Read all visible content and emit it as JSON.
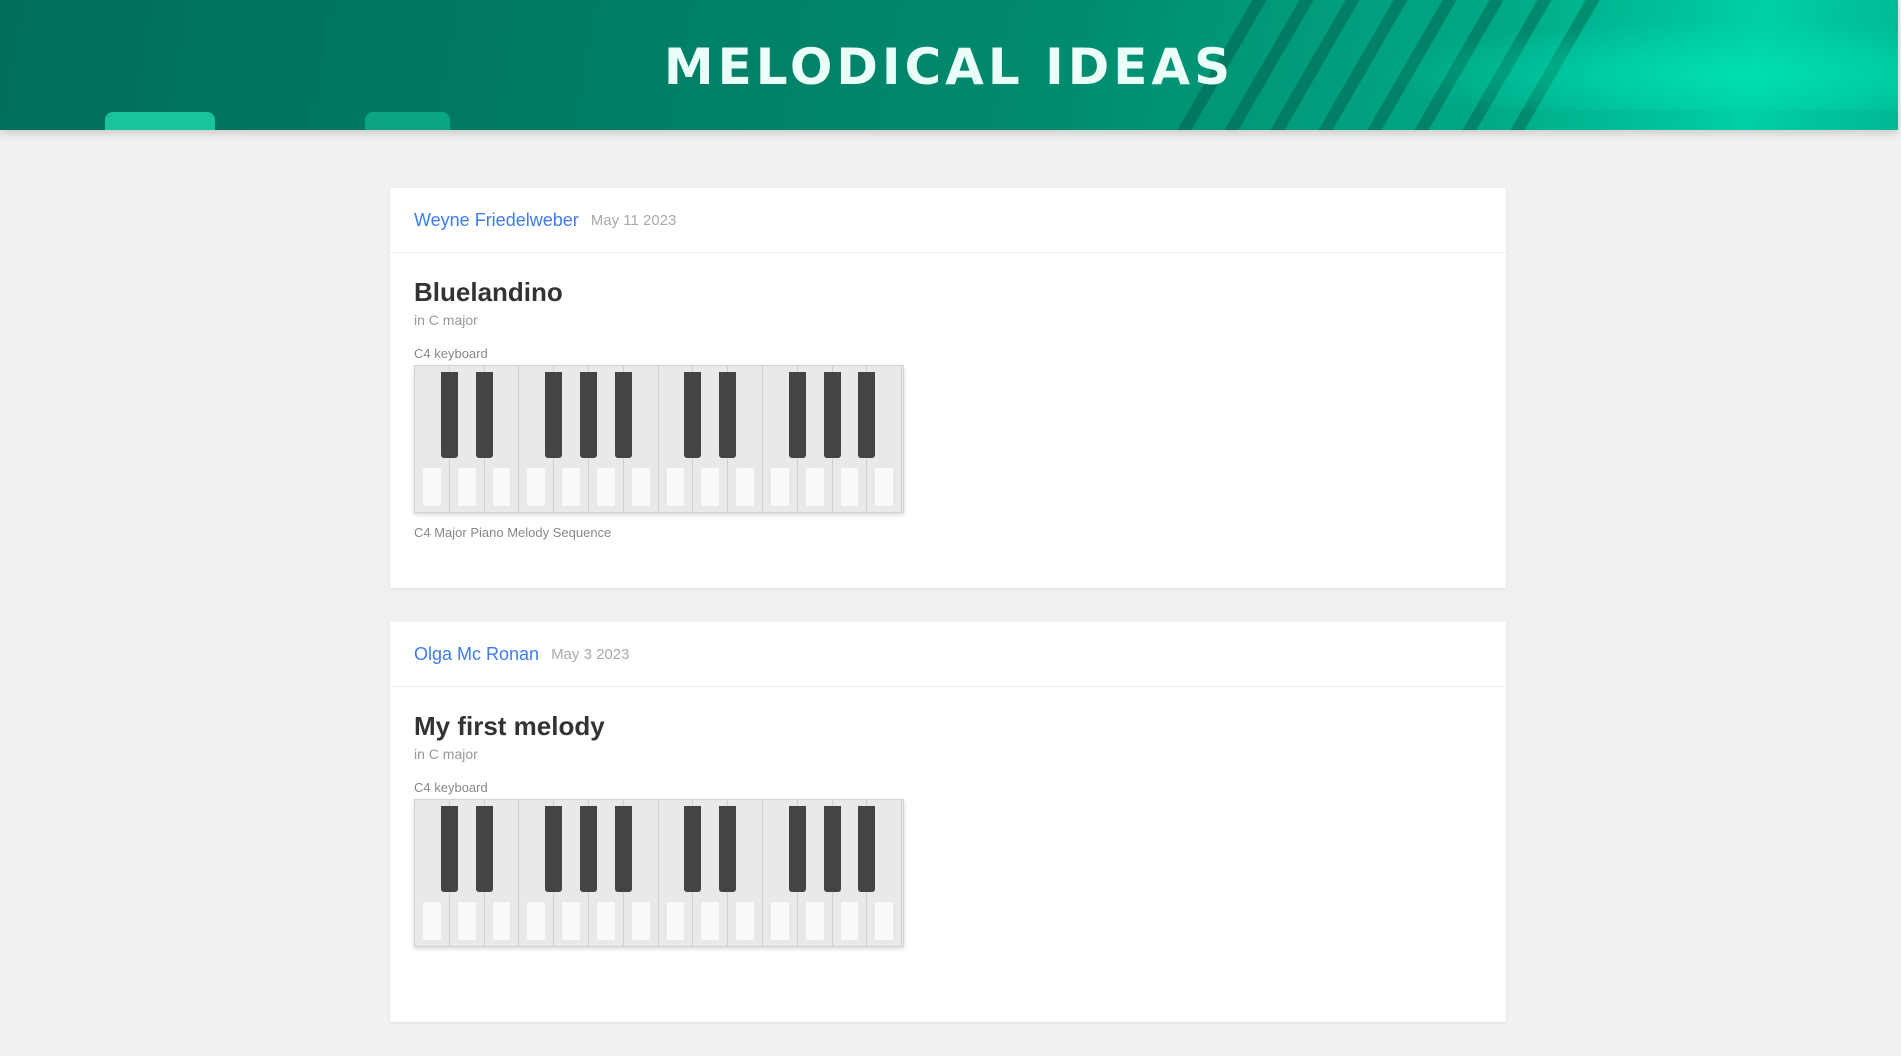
{
  "header": {
    "title": "MELODICAL IDEAS"
  },
  "posts": [
    {
      "author": "Weyne Friedelweber",
      "date": "May 11 2023",
      "song_title": "Bluelandino",
      "song_subtitle": "in C major",
      "keyboard_label": "C4 keyboard",
      "caption": "C4 Major Piano Melody Sequence"
    },
    {
      "author": "Olga Mc Ronan",
      "date": "May 3 2023",
      "song_title": "My first melody",
      "song_subtitle": "in C major",
      "keyboard_label": "C4 keyboard",
      "caption": ""
    }
  ]
}
